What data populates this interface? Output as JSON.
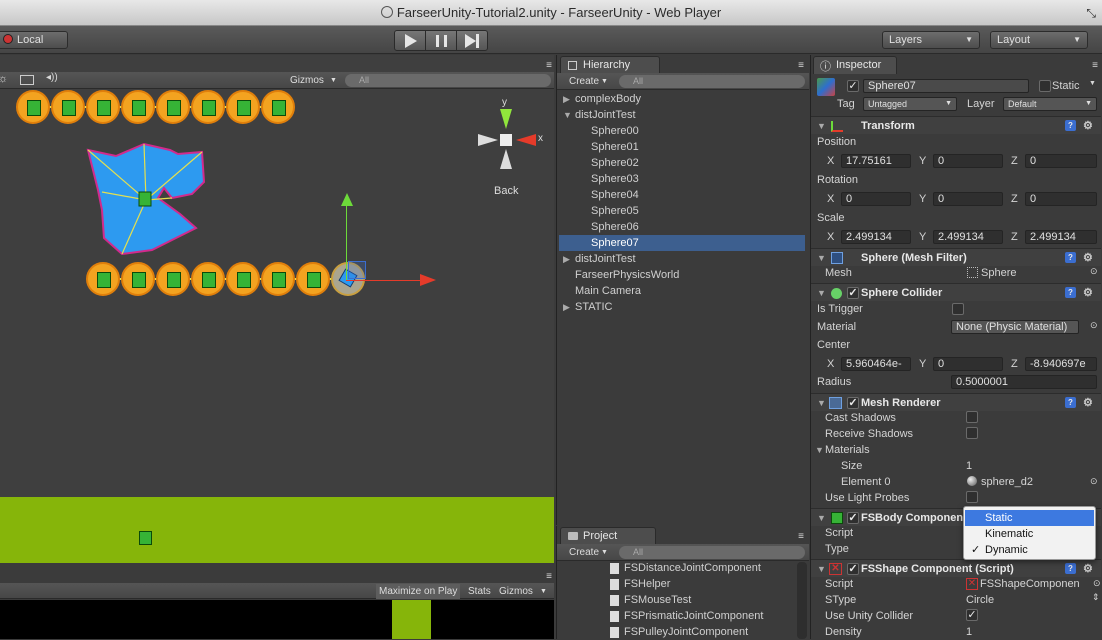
{
  "window": {
    "title": "FarseerUnity-Tutorial2.unity - FarseerUnity - Web Player"
  },
  "toolbar": {
    "pivot_mode": "Local",
    "play_icon": "play-icon",
    "pause_icon": "pause-icon",
    "step_icon": "step-icon",
    "layers": "Layers",
    "layout": "Layout"
  },
  "scene": {
    "gizmos": "Gizmos",
    "search_placeholder": "All",
    "gizmo_back": "Back",
    "axis_y": "y",
    "axis_x": "x"
  },
  "game": {
    "maximize": "Maximize on Play",
    "stats": "Stats",
    "gizmos": "Gizmos"
  },
  "hierarchy": {
    "tab": "Hierarchy",
    "create": "Create",
    "search_placeholder": "All",
    "items": [
      {
        "label": "complexBody",
        "expandable": true,
        "expanded": false,
        "indent": 0
      },
      {
        "label": "distJointTest",
        "expandable": true,
        "expanded": true,
        "indent": 0
      },
      {
        "label": "Sphere00",
        "indent": 1
      },
      {
        "label": "Sphere01",
        "indent": 1
      },
      {
        "label": "Sphere02",
        "indent": 1
      },
      {
        "label": "Sphere03",
        "indent": 1
      },
      {
        "label": "Sphere04",
        "indent": 1
      },
      {
        "label": "Sphere05",
        "indent": 1
      },
      {
        "label": "Sphere06",
        "indent": 1
      },
      {
        "label": "Sphere07",
        "indent": 1,
        "selected": true
      },
      {
        "label": "distJointTest",
        "expandable": true,
        "expanded": false,
        "indent": 0
      },
      {
        "label": "FarseerPhysicsWorld",
        "indent": 0
      },
      {
        "label": "Main Camera",
        "indent": 0
      },
      {
        "label": "STATIC",
        "expandable": true,
        "expanded": false,
        "indent": 0
      }
    ]
  },
  "project": {
    "tab": "Project",
    "create": "Create",
    "search_placeholder": "All",
    "items": [
      "FSDistanceJointComponent",
      "FSHelper",
      "FSMouseTest",
      "FSPrismaticJointComponent",
      "FSPulleyJointComponent"
    ]
  },
  "inspector": {
    "tab": "Inspector",
    "object_name": "Sphere07",
    "static_label": "Static",
    "tag_label": "Tag",
    "tag_value": "Untagged",
    "layer_label": "Layer",
    "layer_value": "Default",
    "transform": {
      "title": "Transform",
      "position_label": "Position",
      "rotation_label": "Rotation",
      "scale_label": "Scale",
      "x": "X",
      "y": "Y",
      "z": "Z",
      "position": [
        "17.75161",
        "0",
        "0"
      ],
      "rotation": [
        "0",
        "0",
        "0"
      ],
      "scale": [
        "2.499134",
        "2.499134",
        "2.499134"
      ]
    },
    "mesh_filter": {
      "title": "Sphere (Mesh Filter)",
      "mesh_label": "Mesh",
      "mesh_value": "Sphere"
    },
    "sphere_collider": {
      "title": "Sphere Collider",
      "is_trigger": "Is Trigger",
      "material_label": "Material",
      "material_value": "None (Physic Material)",
      "center_label": "Center",
      "center": [
        "5.960464e-",
        "0",
        "-8.940697e"
      ],
      "radius_label": "Radius",
      "radius_value": "0.5000001"
    },
    "mesh_renderer": {
      "title": "Mesh Renderer",
      "cast_shadows": "Cast Shadows",
      "receive_shadows": "Receive Shadows",
      "materials": "Materials",
      "size_label": "Size",
      "size_value": "1",
      "element0_label": "Element 0",
      "element0_value": "sphere_d2",
      "light_probes": "Use Light Probes"
    },
    "fsbody": {
      "title": "FSBody Componen",
      "script_label": "Script",
      "type_label": "Type"
    },
    "fsshape": {
      "title": "FSShape Component (Script)",
      "script_label": "Script",
      "script_value": "FSShapeComponen",
      "stype_label": "SType",
      "stype_value": "Circle",
      "unity_collider_label": "Use Unity Collider",
      "density_label": "Density",
      "density_value": "1"
    },
    "type_dropdown": {
      "options": [
        "Static",
        "Kinematic",
        "Dynamic"
      ],
      "highlighted": "Static",
      "checked": "Dynamic",
      "check_mark": "✓"
    }
  },
  "colors": {
    "selection": "#3d5f8f",
    "ground": "#86b50a",
    "node": "#f3a320",
    "shape": "#2d9af0"
  }
}
